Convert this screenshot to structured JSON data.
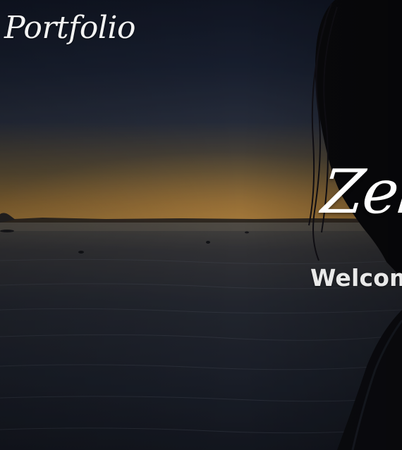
{
  "nav": {
    "brand_label": "Portfolio"
  },
  "hero": {
    "title": "Zelu",
    "subtitle": "Welcom",
    "background": "sunset-lake-portrait-photo"
  },
  "colors": {
    "sky_top": "#1c2438",
    "horizon_glow": "#b58a45",
    "water": "#1f2430",
    "text": "#ffffff"
  }
}
